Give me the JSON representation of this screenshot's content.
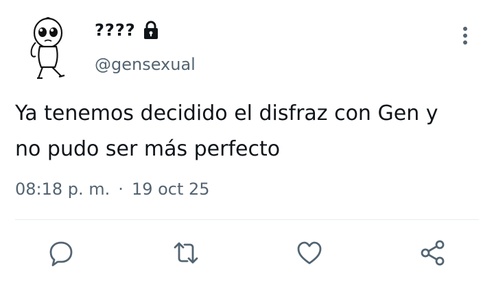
{
  "tweet": {
    "display_name": "????",
    "handle": "@gensexual",
    "text": "Ya tenemos decidido el disfraz con Gen y\nno pudo ser más perfecto",
    "time": "08:18 p. m.",
    "separator": "·",
    "date": "19 oct 25",
    "avatar_icon": "cartoon-character-avatar",
    "protected_icon": "lock-icon",
    "more_icon": "vertical-ellipsis-icon"
  },
  "actions": {
    "reply_icon": "reply-icon",
    "retweet_icon": "retweet-icon",
    "like_icon": "heart-icon",
    "share_icon": "share-icon"
  },
  "colors": {
    "text": "#0f1419",
    "secondary": "#536471",
    "divider": "#e6ecf0"
  }
}
